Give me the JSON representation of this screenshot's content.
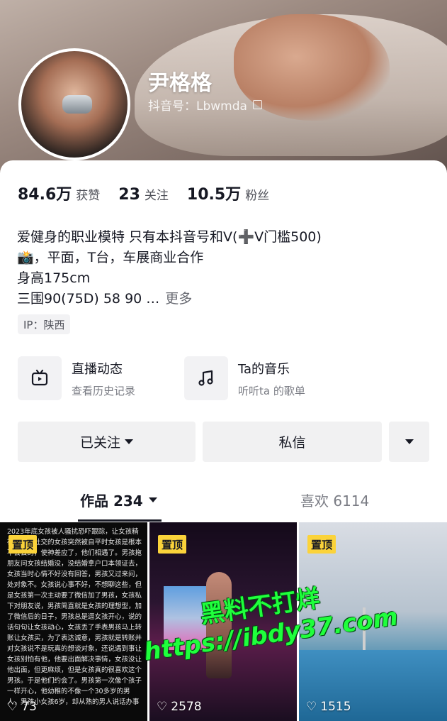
{
  "profile": {
    "name": "尹格格",
    "douyin_id": "抖音号：Lbwmda"
  },
  "stats": [
    {
      "value": "84.6万",
      "label": "获赞"
    },
    {
      "value": "23",
      "label": "关注"
    },
    {
      "value": "10.5万",
      "label": "粉丝"
    }
  ],
  "bio": {
    "lines": [
      "爱健身的职业模特 只有本抖音号和V(➕V门槛500)",
      "📸，平面，T台，车展商业合作",
      "身高175cm",
      "三围90(75D) 58 90 …"
    ],
    "more": "更多"
  },
  "ip": "IP：陕西",
  "features": [
    {
      "title": "直播动态",
      "subtitle": "查看历史记录",
      "icon": "tv-icon"
    },
    {
      "title": "Ta的音乐",
      "subtitle": "听听ta 的歌单",
      "icon": "music-note-icon"
    }
  ],
  "actions": {
    "follow": "已关注",
    "message": "私信"
  },
  "tabs": [
    {
      "label": "作品 234",
      "active": true
    },
    {
      "label": "喜欢 6114",
      "active": false
    }
  ],
  "videos": [
    {
      "pinned": "置顶",
      "likes": "73",
      "text": "2023年底女孩被人骚扰恐吓跟踪，让女孩精神从来不社交的女孩突然被自平时女孩是根本不会去的，使神差应了，他们相遇了。男孩拖朋友问女孩结婚没，没结婚拿户口本领证去，女孩当时心情不好没有回答，男孩又过来问，处对象不。女孩说心事不好，不想聊这些，但是女孩第一次主动要了微信加了男孩，女孩私下对朋友说，男孩简直就是女孩的理想型，加了微信后的日子，男孩总是逗女孩开心，说的话句句让女孩动心，女孩丢了手表男孩马上转账让女孩买，为了表达诚意，男孩就是转账并对女孩说不是玩真的想谈对象，还说遇到事让女孩别怕有他，他要出面解决事情，女孩没让他出面，但更麻烦，但是女孩真的很喜欢这个男孩。于是他们约会了。男孩第一次像个孩子一样开心，他幼稚的不像一个30多岁的男人，男孩小女孩6岁，却从熟的男人说话办事"
    },
    {
      "pinned": "置顶",
      "likes": "2578"
    },
    {
      "pinned": "置顶",
      "likes": "1515"
    }
  ],
  "watermark": {
    "line1": "黑料不打烊",
    "line2": "https://ibdy37.com"
  },
  "colors": {
    "pin_badge": "#fbd33a",
    "watermark": "#1fff3c",
    "button_bg": "#f1f1f2"
  }
}
